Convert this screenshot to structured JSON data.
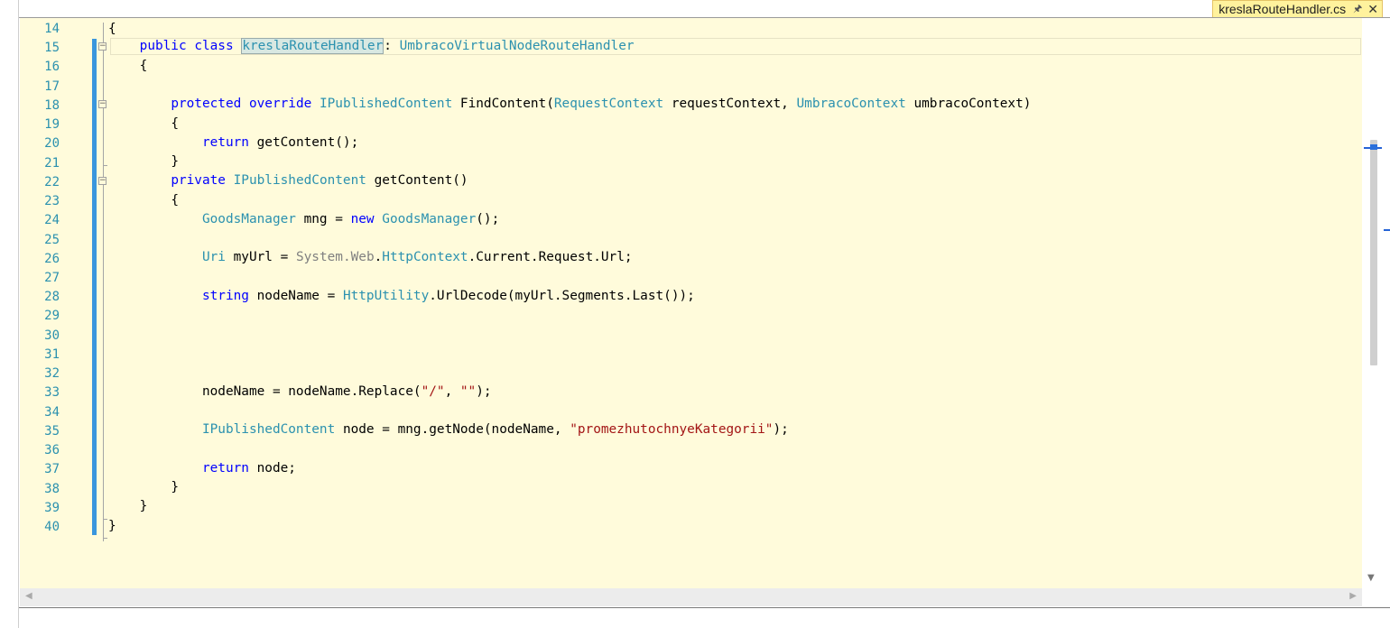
{
  "tab": {
    "filename": "kreslaRouteHandler.cs",
    "pin_icon": "pin-icon",
    "close_icon": "close-icon"
  },
  "colors": {
    "editor_bg": "#fffbdb",
    "keyword": "#0000ff",
    "type": "#2b91af",
    "string": "#a31515",
    "line_number": "#2b91af",
    "change_bar": "#3a96dd",
    "tab_bg": "#fff29d"
  },
  "line_numbers": [
    "14",
    "15",
    "16",
    "17",
    "18",
    "19",
    "20",
    "21",
    "22",
    "23",
    "24",
    "25",
    "26",
    "27",
    "28",
    "29",
    "30",
    "31",
    "32",
    "33",
    "34",
    "35",
    "36",
    "37",
    "38",
    "39",
    "40"
  ],
  "code": {
    "l14": {
      "brace": "{"
    },
    "l15": {
      "kw1": "public",
      "kw2": "class",
      "name": "kreslaRouteHandler",
      "sep": ":",
      "base": "UmbracoVirtualNodeRouteHandler"
    },
    "l16": {
      "brace": "{"
    },
    "l18": {
      "kw1": "protected",
      "kw2": "override",
      "ret": "IPublishedContent",
      "method": "FindContent(",
      "p1type": "RequestContext",
      "p1": "requestContext,",
      "p2type": "UmbracoContext",
      "p2": "umbracoContext)"
    },
    "l19": {
      "brace": "{"
    },
    "l20": {
      "kw": "return",
      "rest": "getContent();"
    },
    "l21": {
      "brace": "}"
    },
    "l22": {
      "kw": "private",
      "ret": "IPublishedContent",
      "method": "getContent()"
    },
    "l23": {
      "brace": "{"
    },
    "l24": {
      "type": "GoodsManager",
      "var": "mng =",
      "kw": "new",
      "type2": "GoodsManager",
      "rest": "();"
    },
    "l26": {
      "type": "Uri",
      "var": "myUrl =",
      "ns1": "System",
      "ns2": "Web",
      "type2": "HttpContext",
      "rest": ".Current.Request.Url;"
    },
    "l28": {
      "kw": "string",
      "var": "nodeName =",
      "type": "HttpUtility",
      "rest": ".UrlDecode(myUrl.Segments.Last());"
    },
    "l33": {
      "pre": "nodeName = nodeName.Replace(",
      "s1": "\"/\"",
      "mid": ", ",
      "s2": "\"\"",
      "post": ");"
    },
    "l35": {
      "type": "IPublishedContent",
      "pre": "node = mng.getNode(nodeName, ",
      "s1": "\"promezhutochnyeKategorii\"",
      "post": ");"
    },
    "l37": {
      "kw": "return",
      "rest": "node;"
    },
    "l38": {
      "brace": "}"
    },
    "l39": {
      "brace": "}"
    },
    "l40": {
      "brace": "}"
    }
  }
}
